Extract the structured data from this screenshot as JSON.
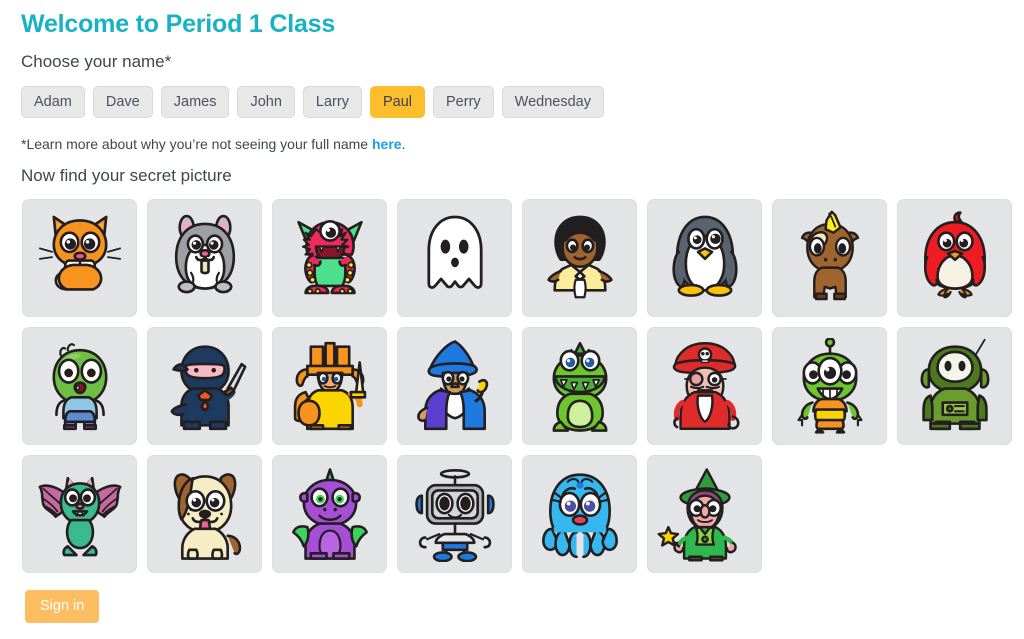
{
  "header": {
    "title": "Welcome to Period 1 Class",
    "title_color": "#17b3c4",
    "choose_name_label": "Choose your name*"
  },
  "names": {
    "selected": "Paul",
    "selected_bg": "#fcbe2d",
    "options": [
      {
        "label": "Adam",
        "selected": false
      },
      {
        "label": "Dave",
        "selected": false
      },
      {
        "label": "James",
        "selected": false
      },
      {
        "label": "John",
        "selected": false
      },
      {
        "label": "Larry",
        "selected": false
      },
      {
        "label": "Paul",
        "selected": true
      },
      {
        "label": "Perry",
        "selected": false
      },
      {
        "label": "Wednesday",
        "selected": false
      }
    ]
  },
  "footnote": {
    "text_before": "*Learn more about why you’re not seeing your full name ",
    "link_label": "here",
    "link_color": "#1ba1e2",
    "text_after": "."
  },
  "secret_picture": {
    "heading": "Now find your secret picture",
    "card_bg": "#e3e4e6",
    "avatars": [
      {
        "name": "cat-avatar",
        "label": "Cat"
      },
      {
        "name": "hamster-avatar",
        "label": "Hamster"
      },
      {
        "name": "monster-avatar",
        "label": "Monster"
      },
      {
        "name": "ghost-avatar",
        "label": "Ghost"
      },
      {
        "name": "princess-avatar",
        "label": "Princess"
      },
      {
        "name": "penguin-avatar",
        "label": "Penguin"
      },
      {
        "name": "unicorn-avatar",
        "label": "Unicorn"
      },
      {
        "name": "bird-avatar",
        "label": "Bird"
      },
      {
        "name": "zombie-avatar",
        "label": "Zombie"
      },
      {
        "name": "ninja-avatar",
        "label": "Ninja"
      },
      {
        "name": "knight-avatar",
        "label": "Knight"
      },
      {
        "name": "wizard-avatar",
        "label": "Wizard"
      },
      {
        "name": "dinosaur-avatar",
        "label": "Dinosaur"
      },
      {
        "name": "pirate-avatar",
        "label": "Pirate"
      },
      {
        "name": "alien-avatar",
        "label": "Alien"
      },
      {
        "name": "green-robot-avatar",
        "label": "Green Robot"
      },
      {
        "name": "bat-avatar",
        "label": "Bat"
      },
      {
        "name": "dog-avatar",
        "label": "Dog"
      },
      {
        "name": "dragon-avatar",
        "label": "Dragon"
      },
      {
        "name": "robot-avatar",
        "label": "Robot"
      },
      {
        "name": "octopus-avatar",
        "label": "Octopus"
      },
      {
        "name": "witch-avatar",
        "label": "Witch"
      }
    ]
  },
  "signin": {
    "label": "Sign in",
    "bg": "#fcbe60"
  }
}
